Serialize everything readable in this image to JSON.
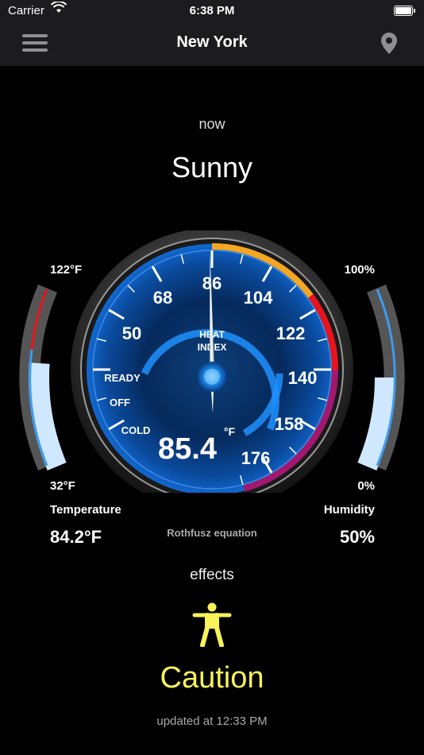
{
  "status_bar": {
    "carrier": "Carrier",
    "time": "6:38 PM"
  },
  "nav": {
    "title": "New York",
    "menu_icon": "hamburger-menu-icon",
    "location_icon": "location-pin-icon"
  },
  "current": {
    "period": "now",
    "condition": "Sunny"
  },
  "temperature_meter": {
    "max_label": "122°F",
    "min_label": "32°F",
    "label": "Temperature",
    "value": "84.2°F",
    "level": 0.58,
    "color": "#3d9bf0"
  },
  "humidity_meter": {
    "max_label": "100%",
    "min_label": "0%",
    "label": "Humidity",
    "value": "50%",
    "level": 0.5,
    "color": "#3d9bf0"
  },
  "gauge": {
    "title_line1": "HEAT",
    "title_line2": "INDEX",
    "reading": "85.4",
    "unit": "°F",
    "needle_value": 85.4,
    "scale_labels": [
      "50",
      "68",
      "86",
      "104",
      "122",
      "140",
      "158",
      "176"
    ],
    "inner_labels": [
      "READY",
      "OFF",
      "COLD"
    ],
    "accent_blue": "#1e90ff",
    "zones": {
      "caution": "#f5a623",
      "danger": "#e8141b",
      "extreme": "#a3186f"
    }
  },
  "equation": "Rothfusz equation",
  "effects": {
    "label": "effects",
    "icon": "person-figure-icon",
    "level": "Caution",
    "color": "#f7f35a"
  },
  "updated": "updated at 12:33 PM"
}
